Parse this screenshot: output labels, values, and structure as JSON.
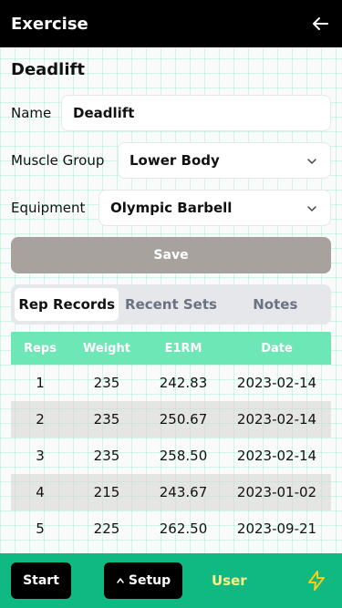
{
  "header": {
    "title": "Exercise",
    "back_icon": "arrow-left-icon"
  },
  "exercise": {
    "heading": "Deadlift"
  },
  "form": {
    "name_label": "Name",
    "name_value": "Deadlift",
    "muscle_label": "Muscle Group",
    "muscle_value": "Lower Body",
    "equipment_label": "Equipment",
    "equipment_value": "Olympic Barbell",
    "save_label": "Save"
  },
  "tabs": [
    {
      "label": "Rep Records",
      "active": true
    },
    {
      "label": "Recent Sets",
      "active": false
    },
    {
      "label": "Notes",
      "active": false
    }
  ],
  "table": {
    "headers": [
      "Reps",
      "Weight",
      "E1RM",
      "Date"
    ],
    "rows": [
      [
        "1",
        "235",
        "242.83",
        "2023-02-14"
      ],
      [
        "2",
        "235",
        "250.67",
        "2023-02-14"
      ],
      [
        "3",
        "235",
        "258.50",
        "2023-02-14"
      ],
      [
        "4",
        "215",
        "243.67",
        "2023-01-02"
      ],
      [
        "5",
        "225",
        "262.50",
        "2023-09-21"
      ]
    ]
  },
  "footer": {
    "start_label": "Start",
    "setup_label": "Setup",
    "setup_icon": "caret-up-icon",
    "user_label": "User",
    "bolt_icon": "lightning-bolt-icon"
  },
  "colors": {
    "accent": "#10b981",
    "table_header": "#6ee7b7",
    "save_button": "#a8a29e",
    "user_link": "#fef08a",
    "bolt": "#facc15"
  }
}
